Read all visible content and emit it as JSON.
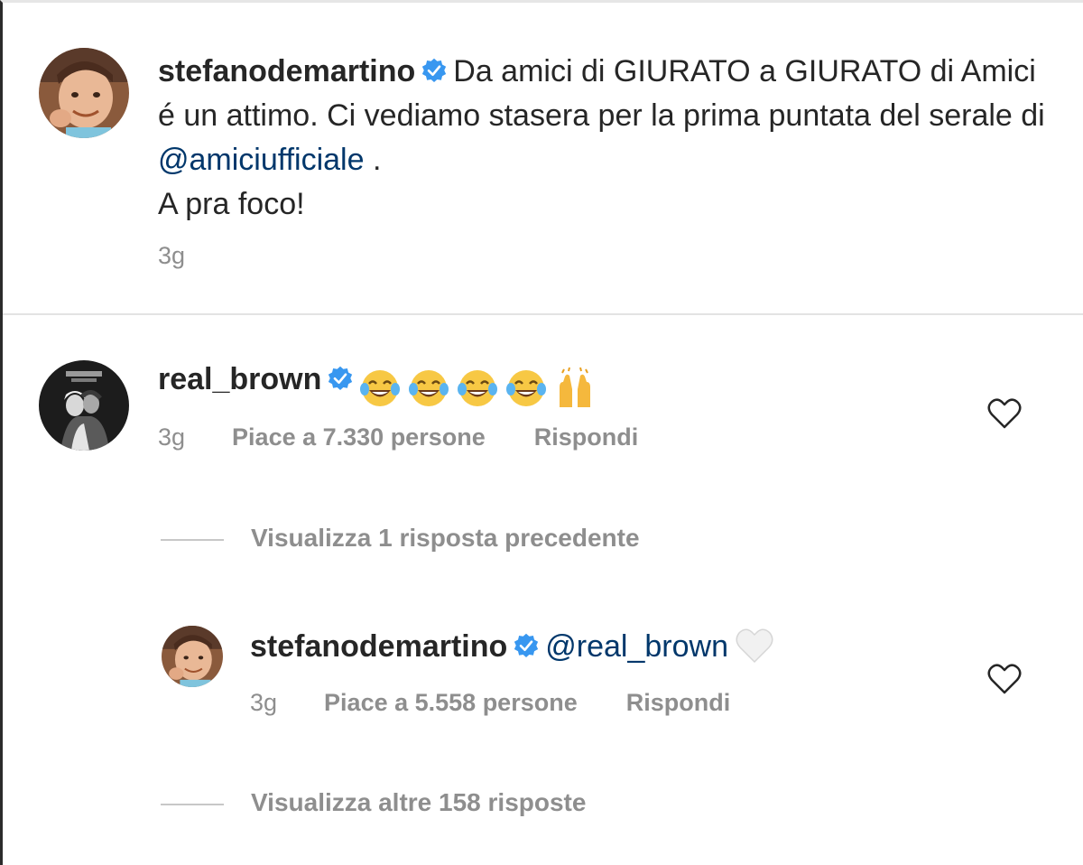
{
  "caption": {
    "avatar": "stefanodemartino-avatar",
    "username": "stefanodemartino",
    "verified_icon": "verified-badge-icon",
    "text_part1": "Da amici di GIURATO a GIURATO di Amici é un attimo. Ci vediamo stasera per la prima puntata del serale di",
    "mention": "@amiciufficiale",
    "text_part2": ".",
    "text_line_last": "A pra foco!",
    "time": "3g"
  },
  "comments": [
    {
      "username": "real_brown",
      "emojis": [
        "face-with-tears-of-joy",
        "face-with-tears-of-joy",
        "face-with-tears-of-joy",
        "face-with-tears-of-joy",
        "raising-hands"
      ],
      "time": "3g",
      "likes": "Piace a 7.330 persone",
      "reply_label": "Rispondi",
      "view_previous": "Visualizza 1 risposta precedente",
      "replies": [
        {
          "username": "stefanodemartino",
          "mention": "@real_brown",
          "emoji": "white-heart",
          "time": "3g",
          "likes": "Piace a 5.558 persone",
          "reply_label": "Rispondi"
        }
      ],
      "view_more": "Visualizza altre 158 risposte"
    }
  ],
  "colors": {
    "text": "#262626",
    "secondary": "#8e8e8e",
    "mention": "#00376b",
    "verified": "#3897f0"
  }
}
